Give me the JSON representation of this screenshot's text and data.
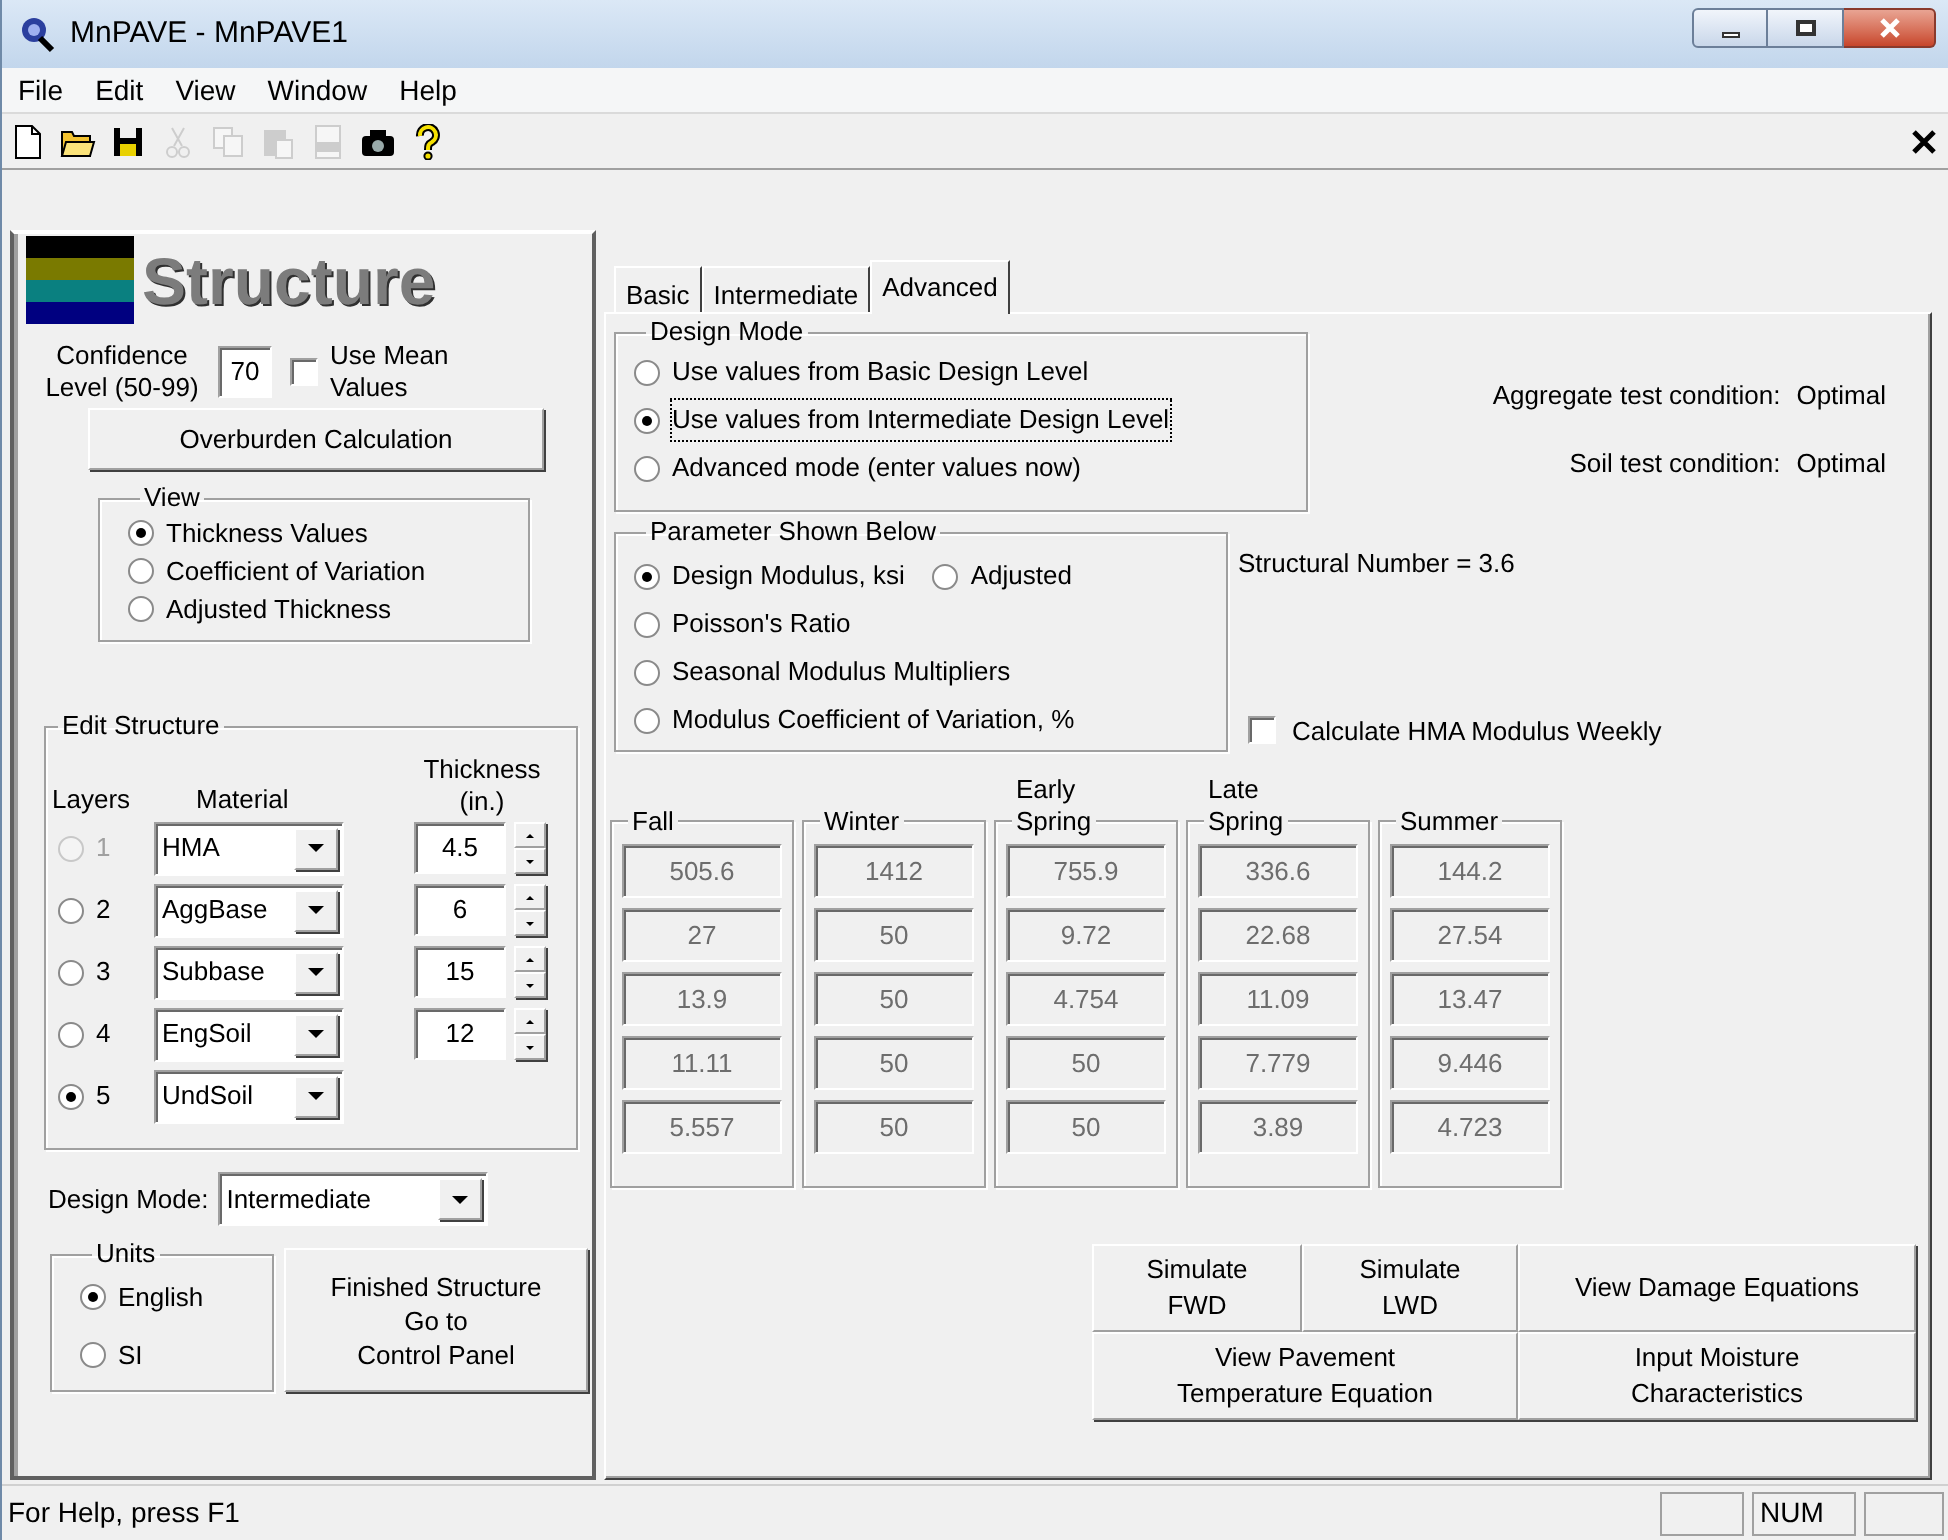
{
  "window": {
    "title": "MnPAVE - MnPAVE1"
  },
  "menu": [
    "File",
    "Edit",
    "View",
    "Window",
    "Help"
  ],
  "toolbar": [
    {
      "kind": "new",
      "disabled": false
    },
    {
      "kind": "open",
      "disabled": false
    },
    {
      "kind": "save",
      "disabled": false
    },
    {
      "kind": "cut",
      "disabled": true
    },
    {
      "kind": "copy",
      "disabled": true
    },
    {
      "kind": "paste",
      "disabled": true
    },
    {
      "kind": "pdf",
      "disabled": true
    },
    {
      "kind": "camera",
      "disabled": false
    },
    {
      "kind": "help",
      "disabled": false
    }
  ],
  "structure": {
    "title": "Structure",
    "confidence": {
      "label_lines": [
        "Confidence",
        "Level (50-99)"
      ],
      "value": "70"
    },
    "use_mean": {
      "label_lines": [
        "Use Mean",
        "Values"
      ],
      "checked": false
    },
    "overburden_button": "Overburden Calculation",
    "view": {
      "title": "View",
      "options": [
        {
          "label": "Thickness Values",
          "selected": true
        },
        {
          "label": "Coefficient of Variation",
          "selected": false
        },
        {
          "label": "Adjusted Thickness",
          "selected": false
        }
      ]
    },
    "edit_structure": {
      "title": "Edit Structure",
      "headers": {
        "layers": "Layers",
        "material": "Material",
        "thickness_lines": [
          "Thickness",
          "(in.)"
        ]
      },
      "rows": [
        {
          "number": "1",
          "selected": false,
          "disabled": true,
          "material": "HMA",
          "thickness": "4.5"
        },
        {
          "number": "2",
          "selected": false,
          "disabled": false,
          "material": "AggBase",
          "thickness": "6"
        },
        {
          "number": "3",
          "selected": false,
          "disabled": false,
          "material": "Subbase",
          "thickness": "15"
        },
        {
          "number": "4",
          "selected": false,
          "disabled": false,
          "material": "EngSoil",
          "thickness": "12"
        },
        {
          "number": "5",
          "selected": true,
          "disabled": false,
          "material": "UndSoil"
        }
      ]
    },
    "design_mode": {
      "label": "Design Mode:",
      "value": "Intermediate"
    },
    "units": {
      "title": "Units",
      "options": [
        {
          "label": "English",
          "selected": true
        },
        {
          "label": "SI",
          "selected": false
        }
      ]
    },
    "finished_button_lines": [
      "Finished Structure",
      "Go to",
      "Control Panel"
    ]
  },
  "tabs": [
    {
      "label": "Basic",
      "selected": false
    },
    {
      "label": "Intermediate",
      "selected": false
    },
    {
      "label": "Advanced",
      "selected": true
    }
  ],
  "advanced": {
    "design_mode": {
      "title": "Design Mode",
      "options": [
        {
          "label": "Use values from Basic Design Level",
          "selected": false,
          "focused": false
        },
        {
          "label": "Use values from Intermediate Design Level",
          "selected": true,
          "focused": true
        },
        {
          "label": "Advanced mode (enter values now)",
          "selected": false,
          "focused": false
        }
      ]
    },
    "conditions": [
      {
        "label": "Aggregate test condition:",
        "value": "Optimal"
      },
      {
        "label": "Soil test condition:",
        "value": "Optimal"
      }
    ],
    "parameter": {
      "title": "Parameter Shown Below",
      "options": [
        {
          "label": "Design Modulus,  ksi",
          "selected": true
        },
        {
          "label": "Adjusted",
          "selected": false
        },
        {
          "label": "Poisson's Ratio",
          "selected": false
        },
        {
          "label": "Seasonal Modulus Multipliers",
          "selected": false
        },
        {
          "label": "Modulus Coefficient of Variation, %",
          "selected": false
        }
      ]
    },
    "structural_number": "Structural Number = 3.6",
    "calc_hma": {
      "label": "Calculate HMA Modulus Weekly",
      "checked": false
    },
    "seasons": [
      {
        "label_lines": [
          "Fall"
        ],
        "values": [
          "505.6",
          "27",
          "13.9",
          "11.11",
          "5.557"
        ]
      },
      {
        "label_lines": [
          "Winter"
        ],
        "values": [
          "1412",
          "50",
          "50",
          "50",
          "50"
        ]
      },
      {
        "label_lines": [
          "Early",
          "Spring"
        ],
        "values": [
          "755.9",
          "9.72",
          "4.754",
          "50",
          "50"
        ]
      },
      {
        "label_lines": [
          "Late",
          "Spring"
        ],
        "values": [
          "336.6",
          "22.68",
          "11.09",
          "7.779",
          "3.89"
        ]
      },
      {
        "label_lines": [
          "Summer"
        ],
        "values": [
          "144.2",
          "27.54",
          "13.47",
          "9.446",
          "4.723"
        ]
      }
    ],
    "buttons": [
      {
        "lines": [
          "Simulate",
          "FWD"
        ]
      },
      {
        "lines": [
          "Simulate",
          "LWD"
        ]
      },
      {
        "lines": [
          "View Damage Equations"
        ]
      },
      {
        "lines": [
          "View Pavement",
          "Temperature Equation"
        ]
      },
      {
        "lines": [
          "Input Moisture",
          "Characteristics"
        ]
      }
    ]
  },
  "status_bar": {
    "text": "For Help, press F1",
    "indicator": "NUM"
  }
}
